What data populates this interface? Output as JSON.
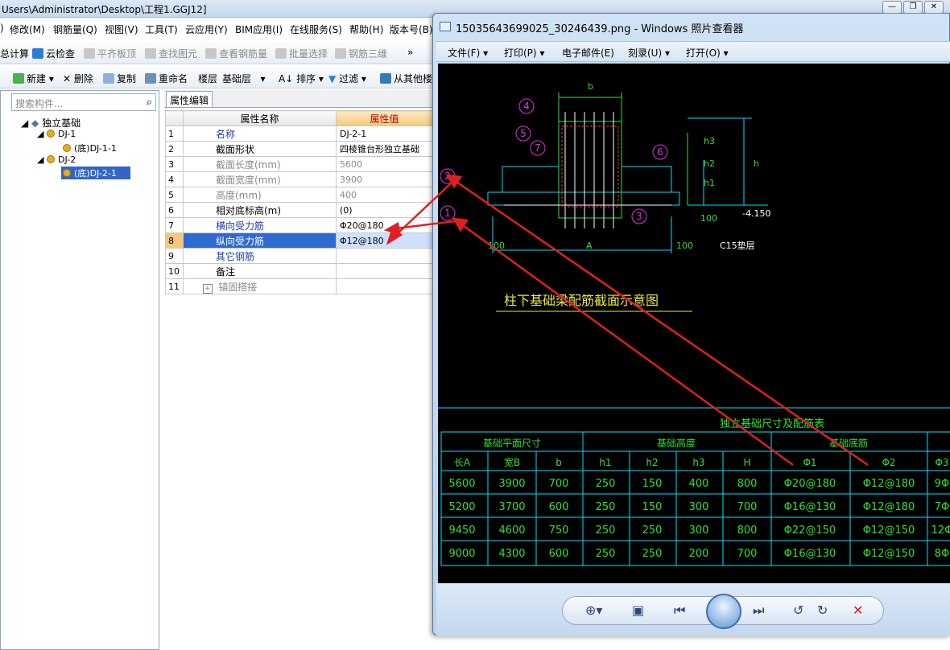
{
  "main_window": {
    "title": "Users\\Administrator\\Desktop\\工程1.GGJ12]",
    "menu": [
      "修改(M)",
      "钢筋量(Q)",
      "视图(V)",
      "工具(T)",
      "云应用(Y)",
      "BIM应用(I)",
      "在线服务(S)",
      "帮助(H)",
      "版本号(B)"
    ],
    "menu_prefix": ")",
    "toolbar1": {
      "calc": "总计算",
      "cloud_check": "云检查",
      "flat_top": "平齐板顶",
      "find_elem": "查找图元",
      "view_rebar": "查看钢筋量",
      "batch_select": "批量选择",
      "rebar_3d": "钢筋三维",
      "more": "»"
    },
    "toolbar2": {
      "new": "新建",
      "delete": "删除",
      "copy": "复制",
      "rename": "重命名",
      "floor_label": "楼层",
      "floor_value": "基础层",
      "sort": "排序",
      "filter": "过滤",
      "from_other": "从其他楼"
    },
    "search_placeholder": "搜索构件...",
    "tree": {
      "root": "独立基础",
      "items": [
        {
          "label": "DJ-1"
        },
        {
          "label": "(底)DJ-1-1"
        },
        {
          "label": "DJ-2"
        },
        {
          "label": "(底)DJ-2-1"
        }
      ]
    },
    "prop_tab": "属性编辑",
    "prop_headers": {
      "name": "属性名称",
      "value": "属性值"
    },
    "props": [
      {
        "n": "1",
        "name": "名称",
        "value": "DJ-2-1"
      },
      {
        "n": "2",
        "name": "截面形状",
        "value": "四棱锥台形独立基础"
      },
      {
        "n": "3",
        "name": "截面长度(mm)",
        "value": "5600"
      },
      {
        "n": "4",
        "name": "截面宽度(mm)",
        "value": "3900"
      },
      {
        "n": "5",
        "name": "高度(mm)",
        "value": "400"
      },
      {
        "n": "6",
        "name": "相对底标高(m)",
        "value": "(0)"
      },
      {
        "n": "7",
        "name": "横向受力筋",
        "value": "Φ20@180"
      },
      {
        "n": "8",
        "name": "纵向受力筋",
        "value": "Φ12@180"
      },
      {
        "n": "9",
        "name": "其它钢筋",
        "value": ""
      },
      {
        "n": "10",
        "name": "备注",
        "value": ""
      },
      {
        "n": "11",
        "name": "锚固搭接",
        "value": ""
      }
    ]
  },
  "viewer": {
    "title": "15035643699025_30246439.png - Windows 照片查看器",
    "menu": [
      "文件(F)",
      "打印(P)",
      "电子邮件(E)",
      "刻录(U)",
      "打开(O)"
    ],
    "drawing": {
      "caption": "柱下基础梁配筋截面示意图",
      "dim_b": "b",
      "dim_A": "A",
      "dim_h": "h",
      "dim_h1": "h1",
      "dim_h2": "h2",
      "dim_h3": "h3",
      "dim_100a": "100",
      "dim_100b": "100",
      "dim_100c": "100",
      "elev": "-4.150",
      "c15": "C15垫层",
      "marks": [
        "4",
        "5",
        "7",
        "6",
        "2",
        "1",
        "3"
      ],
      "table_title": "独立基础尺寸及配筋表",
      "group_headers": [
        "基础平面尺寸",
        "基础高度",
        "基础底筋"
      ],
      "col_headers": [
        "长A",
        "宽B",
        "b",
        "h1",
        "h2",
        "h3",
        "H",
        "Φ1",
        "Φ2",
        "Φ3"
      ],
      "rows": [
        [
          "5600",
          "3900",
          "700",
          "250",
          "150",
          "400",
          "800",
          "Φ20@180",
          "Φ12@180",
          "9Φ"
        ],
        [
          "5200",
          "3700",
          "600",
          "250",
          "150",
          "300",
          "700",
          "Φ16@130",
          "Φ12@180",
          "7Φ"
        ],
        [
          "9450",
          "4600",
          "750",
          "250",
          "250",
          "300",
          "800",
          "Φ22@150",
          "Φ12@150",
          "12Φ"
        ],
        [
          "9000",
          "4300",
          "600",
          "250",
          "250",
          "200",
          "700",
          "Φ16@130",
          "Φ12@150",
          "8Φ"
        ]
      ]
    }
  },
  "colors": {
    "arrow": "#e02020",
    "cad_cyan": "#00e0ff",
    "cad_green": "#30e030",
    "cad_magenta": "#e030e0",
    "cad_yellow": "#e8e840",
    "cad_red": "#ff3030"
  }
}
